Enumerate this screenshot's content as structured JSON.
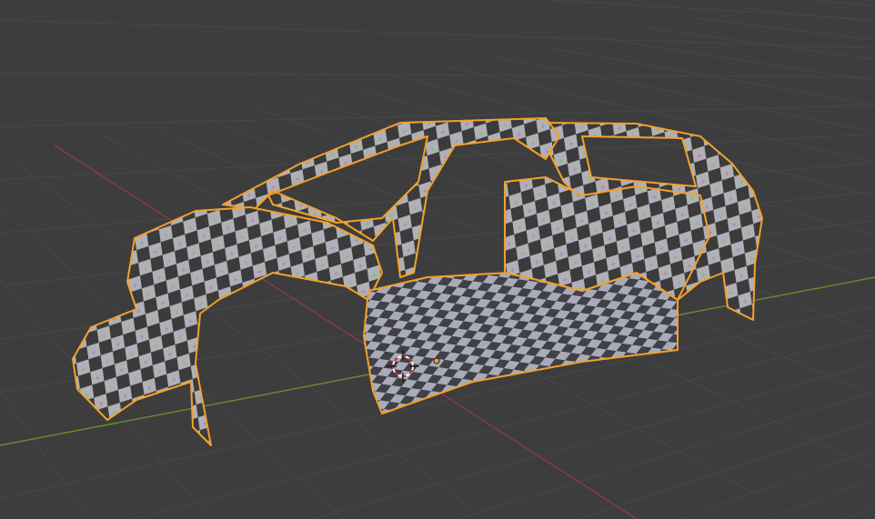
{
  "viewport": {
    "background_color": "#3d3d3d",
    "grid_color": "#474747",
    "x_axis_color": "#8a3a44",
    "y_axis_color": "#6a8f2a",
    "selection_outline_color": "#f5a02a",
    "checker_light": "#b4b4ba",
    "checker_dark": "#3a3a3a",
    "cursor_icon": "3d-cursor-icon",
    "origin_icon": "object-origin-icon"
  }
}
